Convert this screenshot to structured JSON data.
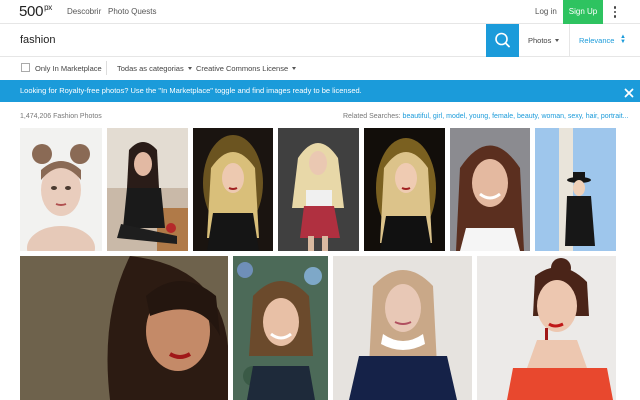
{
  "header": {
    "logo": "500",
    "logo_sup": "px",
    "nav": [
      "Descobrir",
      "Photo Quests"
    ],
    "login": "Log in",
    "signup": "Sign Up"
  },
  "search": {
    "value": "fashion",
    "type_select": "Photos",
    "sort_select": "Relevance"
  },
  "filters": {
    "marketplace_label": "Only In Marketplace",
    "categories": "Todas as categorias",
    "license": "Creative Commons License"
  },
  "banner": {
    "text": "Looking for Royalty-free photos? Use the \"In Marketplace\" toggle and find images ready to be licensed."
  },
  "results": {
    "count": "1,474,206 Fashion Photos",
    "related_label": "Related Searches:",
    "related_terms": [
      "beautiful,",
      "girl,",
      "model,",
      "young,",
      "female,",
      "beauty,",
      "woman,",
      "sexy,",
      "hair,",
      "portrait..."
    ]
  },
  "colors": {
    "accent": "#1b9bda",
    "signup": "#2ec360"
  },
  "icons": [
    "search-icon",
    "close-icon",
    "more-vertical-icon",
    "chevron-down-icon"
  ]
}
